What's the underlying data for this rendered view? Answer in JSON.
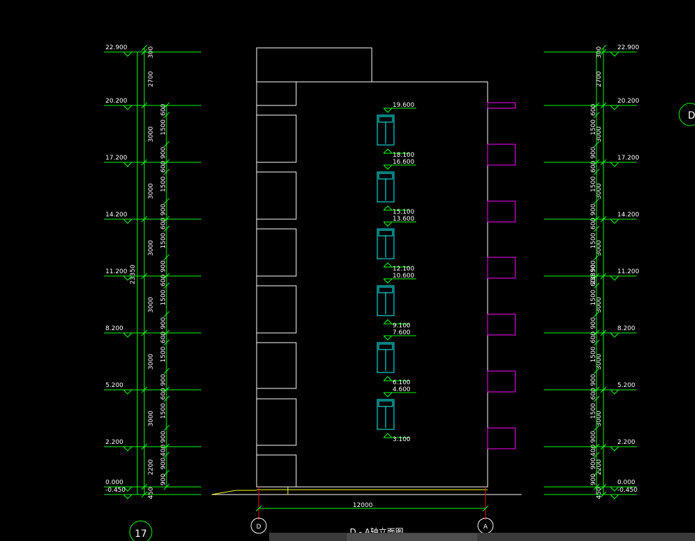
{
  "drawing": {
    "title": "D - A轴立面图",
    "axis_left": "D",
    "axis_right": "A",
    "grid_label_left": "17",
    "grid_label_right": "D",
    "total_width": "12000"
  },
  "elevations": {
    "left": [
      "22.900",
      "20.200",
      "17.200",
      "14.200",
      "11.200",
      "8.200",
      "5.200",
      "2.200",
      "0.000",
      "-0.450"
    ],
    "right": [
      "22.900",
      "20.200",
      "17.200",
      "14.200",
      "11.200",
      "8.200",
      "5.200",
      "2.200",
      "0.000",
      "-0.450"
    ]
  },
  "dimensions": {
    "total_height": "23350",
    "outer": [
      "300",
      "2700",
      "3000",
      "3000",
      "3000",
      "3000",
      "3000",
      "3000",
      "2200",
      "450"
    ],
    "inner": [
      "600",
      "1500",
      "900",
      "600",
      "1500",
      "900",
      "600",
      "1500",
      "900",
      "600",
      "1500",
      "900",
      "600",
      "1500",
      "900",
      "600",
      "1500",
      "900",
      "400",
      "900",
      "900"
    ]
  },
  "windows": [
    {
      "top": "19.600",
      "bottom": "18.100"
    },
    {
      "top": "16.600",
      "bottom": "15.100"
    },
    {
      "top": "13.600",
      "bottom": "12.100"
    },
    {
      "top": "10.600",
      "bottom": "9.100"
    },
    {
      "top": "7.600",
      "bottom": "6.100"
    },
    {
      "top": "4.600",
      "bottom": "3.100"
    }
  ],
  "colors": {
    "background": "#000000",
    "dimension": "#00ff00",
    "outline": "#ffffff",
    "window": "#00ffff",
    "balcony": "#ff00ff",
    "axis": "#ff0000",
    "ground": "#ffff00"
  }
}
